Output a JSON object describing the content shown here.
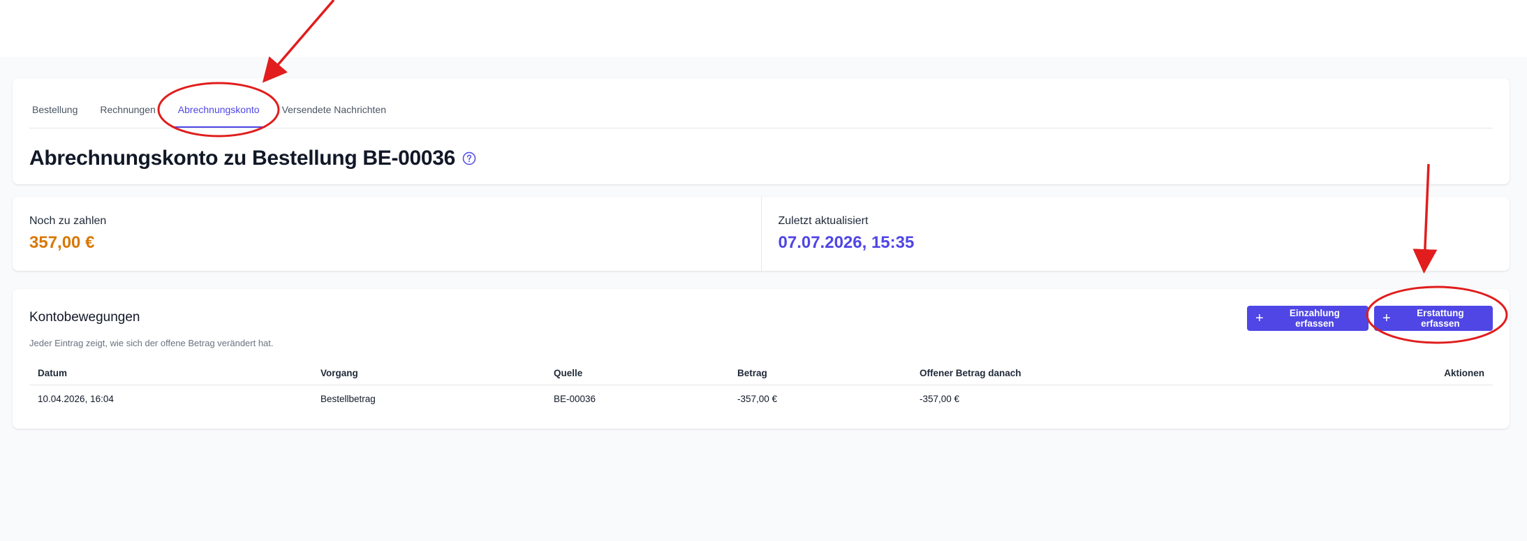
{
  "tabs": [
    {
      "label": "Bestellung"
    },
    {
      "label": "Rechnungen"
    },
    {
      "label": "Abrechnungskonto"
    },
    {
      "label": "Versendete Nachrichten"
    }
  ],
  "active_tab": "Abrechnungskonto",
  "page_title": "Abrechnungskonto zu Bestellung BE-00036",
  "stats": {
    "outstanding_label": "Noch zu zahlen",
    "outstanding_value": "357,00 €",
    "updated_label": "Zuletzt aktualisiert",
    "updated_value": "07.07.2026, 15:35"
  },
  "transactions": {
    "title": "Kontobewegungen",
    "subtitle": "Jeder Eintrag zeigt, wie sich der offene Betrag verändert hat.",
    "deposit_button": "Einzahlung erfassen",
    "refund_button": "Erstattung erfassen",
    "columns": [
      "Datum",
      "Vorgang",
      "Quelle",
      "Betrag",
      "Offener Betrag danach",
      "Aktionen"
    ],
    "rows": [
      {
        "datum": "10.04.2026, 16:04",
        "vorgang": "Bestellbetrag",
        "quelle": "BE-00036",
        "betrag": "-357,00 €",
        "offen": "-357,00 €",
        "aktionen": ""
      }
    ]
  },
  "colors": {
    "accent": "#4f46e5",
    "warning": "#d97706",
    "annotation": "#e11d1d"
  }
}
